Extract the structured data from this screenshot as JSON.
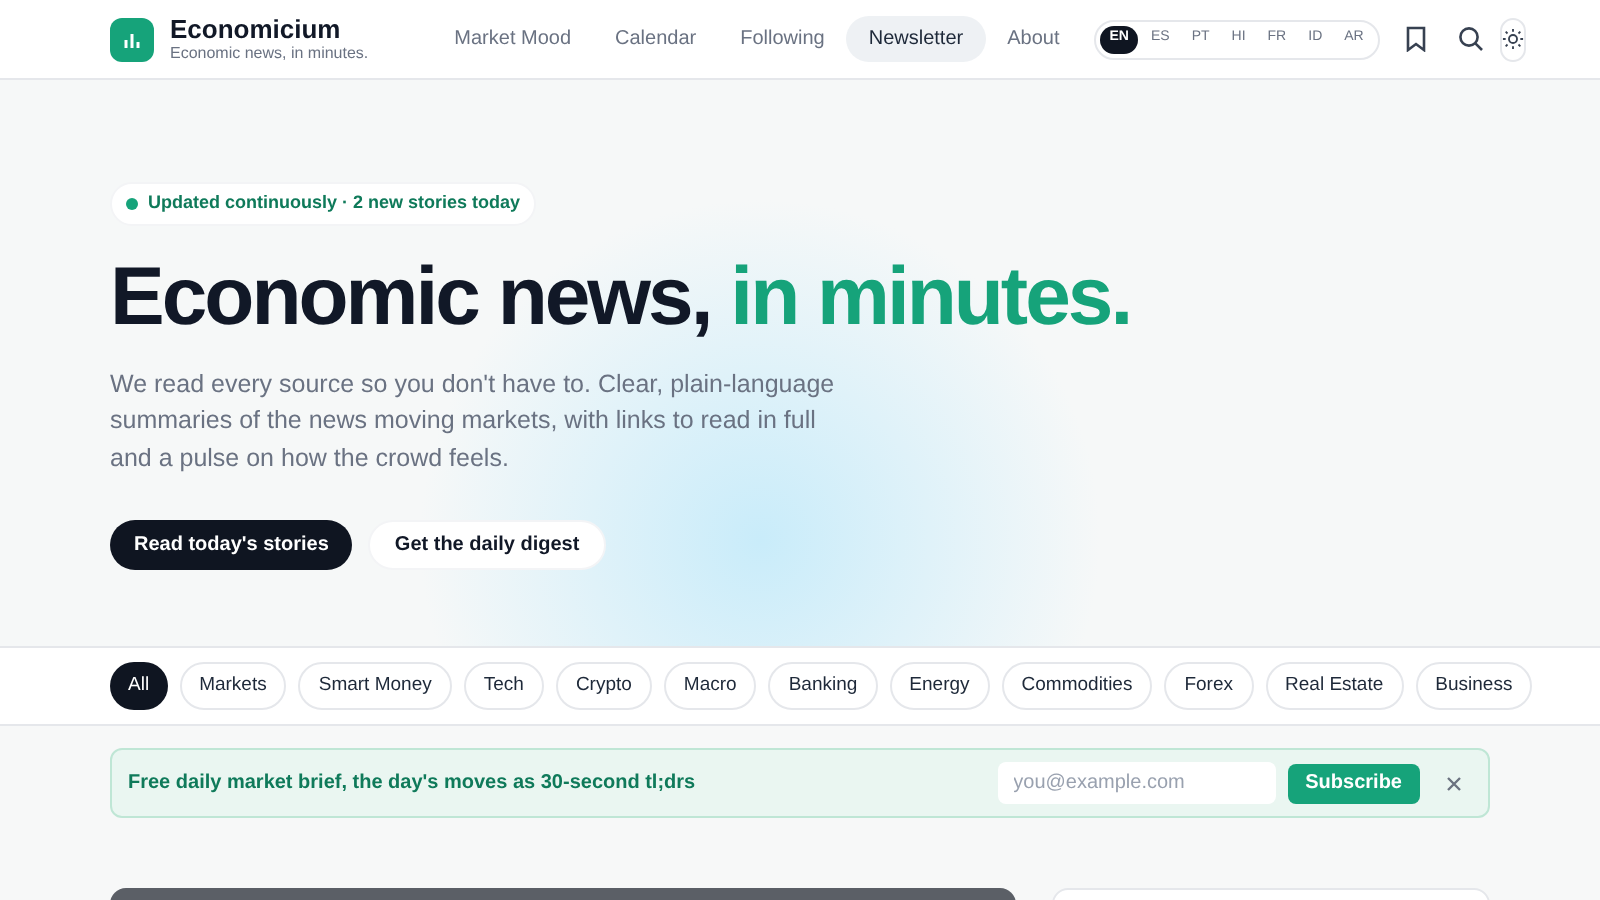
{
  "brand": {
    "name": "Economicium",
    "tagline": "Economic news, in minutes."
  },
  "nav": [
    {
      "label": "Market Mood",
      "selected": false
    },
    {
      "label": "Calendar",
      "selected": false
    },
    {
      "label": "Following",
      "selected": false
    },
    {
      "label": "Newsletter",
      "selected": true
    },
    {
      "label": "About",
      "selected": false
    }
  ],
  "languages": [
    {
      "label": "EN",
      "selected": true
    },
    {
      "label": "ES",
      "selected": false
    },
    {
      "label": "PT",
      "selected": false
    },
    {
      "label": "HI",
      "selected": false
    },
    {
      "label": "FR",
      "selected": false
    },
    {
      "label": "ID",
      "selected": false
    },
    {
      "label": "AR",
      "selected": false
    }
  ],
  "hero": {
    "status": "Updated continuously · 2 new stories today",
    "headline_lead": "Economic news,",
    "headline_accent": "in minutes.",
    "description": "We read every source so you don't have to. Clear, plain-language summaries of the news moving markets, with links to read in full and a pulse on how the crowd feels.",
    "primary_button": "Read today's stories",
    "secondary_button": "Get the daily digest"
  },
  "categories": [
    {
      "label": "All",
      "selected": true
    },
    {
      "label": "Markets",
      "selected": false
    },
    {
      "label": "Smart Money",
      "selected": false
    },
    {
      "label": "Tech",
      "selected": false
    },
    {
      "label": "Crypto",
      "selected": false
    },
    {
      "label": "Macro",
      "selected": false
    },
    {
      "label": "Banking",
      "selected": false
    },
    {
      "label": "Energy",
      "selected": false
    },
    {
      "label": "Commodities",
      "selected": false
    },
    {
      "label": "Forex",
      "selected": false
    },
    {
      "label": "Real Estate",
      "selected": false
    },
    {
      "label": "Business",
      "selected": false
    }
  ],
  "newsletter": {
    "text": "Free daily market brief, the day's moves as 30-second tl;drs",
    "placeholder": "you@example.com",
    "button": "Subscribe"
  }
}
